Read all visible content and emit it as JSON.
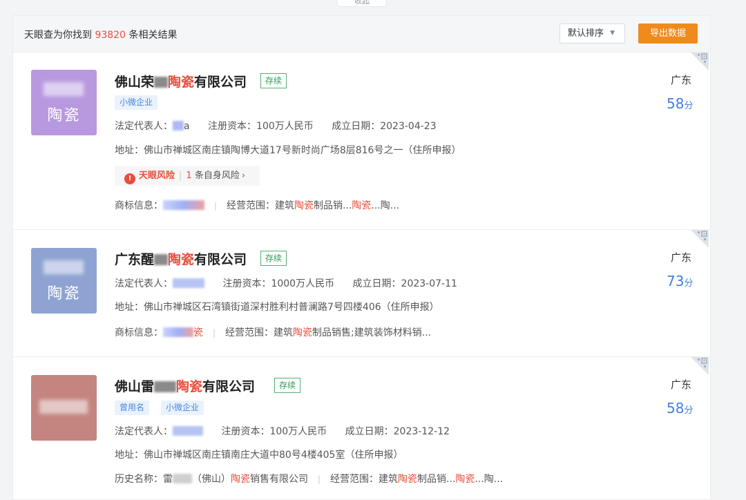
{
  "collapse_label": "收起",
  "toolbar": {
    "result_prefix": "天眼查为你找到",
    "result_count": "93820",
    "result_suffix": "条相关结果",
    "sort_label": "默认排序",
    "export_label": "导出数据"
  },
  "colors": {
    "accent": "#f08a1c",
    "highlight": "#e94e3c",
    "score": "#3f7fe0",
    "status": "#2e9a52"
  },
  "results": [
    {
      "name_pre": "佛山荣",
      "name_hl": "陶瓷",
      "name_post": "有限公司",
      "status": "存续",
      "tags": [
        "小微企业"
      ],
      "logo_text": "陶瓷",
      "logo_color": "#b899e0",
      "legal_rep_label": "法定代表人：",
      "legal_rep_value": "a",
      "capital_label": "注册资本：",
      "capital": "100万人民币",
      "date_label": "成立日期：",
      "date": "2023-04-23",
      "address_label": "地址：",
      "address": "佛山市禅城区南庄镇陶博大道17号新时尚广场8层816号之一（住所申报）",
      "risk": {
        "label": "天眼风险",
        "count": "1",
        "text": "条自身风险"
      },
      "extra_label": "商标信息：",
      "extra_value": "",
      "scope_label": "经营范围：",
      "scope_pre": "建筑",
      "scope_hl": "陶瓷",
      "scope_mid": "制品销...",
      "scope_hl2": "陶瓷",
      "scope_post": "...陶...",
      "region": "广东",
      "score": "58",
      "score_unit": "分"
    },
    {
      "name_pre": "广东醒",
      "name_hl": "陶瓷",
      "name_post": "有限公司",
      "status": "存续",
      "tags": [],
      "logo_text": "陶瓷",
      "logo_color": "#8fa3d3",
      "legal_rep_label": "法定代表人：",
      "legal_rep_value": "",
      "capital_label": "注册资本：",
      "capital": "1000万人民币",
      "date_label": "成立日期：",
      "date": "2023-07-11",
      "address_label": "地址：",
      "address": "佛山市禅城区石湾镇街道深村胜利村普澜路7号四楼406（住所申报）",
      "extra_label": "商标信息：",
      "extra_value": "瓷",
      "scope_label": "经营范围：",
      "scope_pre": "建筑",
      "scope_hl": "陶瓷",
      "scope_mid": "制品销售;建筑装饰材料销...",
      "scope_hl2": "",
      "scope_post": "",
      "region": "广东",
      "score": "73",
      "score_unit": "分"
    },
    {
      "name_pre": "佛山雷",
      "name_hl": "陶瓷",
      "name_post": "有限公司",
      "status": "存续",
      "tags": [
        "曾用名",
        "小微企业"
      ],
      "logo_text": "",
      "logo_color": "#c48580",
      "legal_rep_label": "法定代表人：",
      "legal_rep_value": "",
      "capital_label": "注册资本：",
      "capital": "100万人民币",
      "date_label": "成立日期：",
      "date": "2023-12-12",
      "address_label": "地址：",
      "address": "佛山市禅城区南庄镇南庄大道中80号4楼405室（住所申报）",
      "extra_label": "历史名称：",
      "history_pre": "雷",
      "history_mid": "（佛山）",
      "history_hl": "陶瓷",
      "history_post": "销售有限公司",
      "scope_label": "经营范围：",
      "scope_pre": "建筑",
      "scope_hl": "陶瓷",
      "scope_mid": "制品销...",
      "scope_hl2": "陶瓷",
      "scope_post": "...陶...",
      "region": "广东",
      "score": "58",
      "score_unit": "分"
    }
  ]
}
